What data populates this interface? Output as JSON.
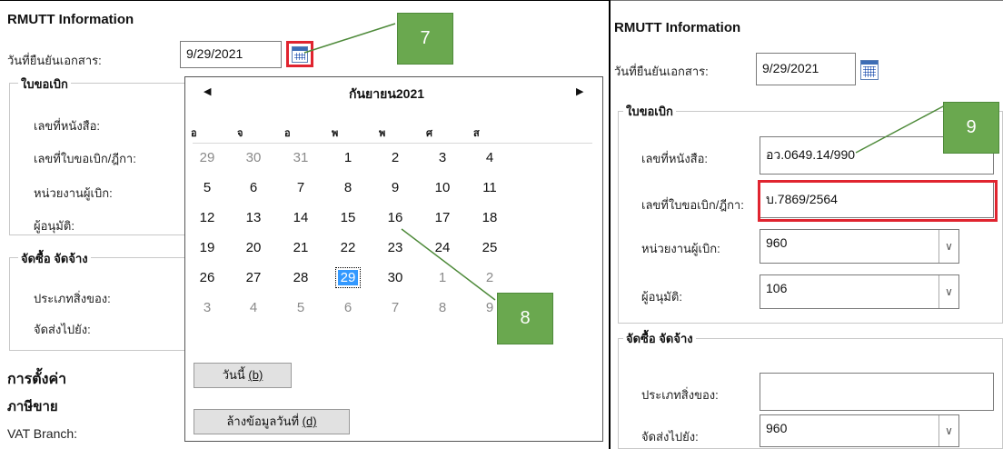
{
  "left": {
    "title": "RMUTT Information",
    "doc_date_label": "วันที่ยืนยันเอกสาร:",
    "doc_date_value": "9/29/2021",
    "group1_title": "ใบขอเบิก",
    "book_no_label": "เลขที่หนังสือ:",
    "req_no_label": "เลขที่ใบขอเบิก/ฎีกา:",
    "dept_label": "หน่วยงานผู้เบิก:",
    "approver_label": "ผู้อนุมัติ:",
    "group2_title": "จัดซื้อ จัดจ้าง",
    "item_type_label": "ประเภทสิ่งของ:",
    "ship_to_label": "จัดส่งไปยัง:",
    "settings_title": "การตั้งค่า",
    "tax_title": "ภาษีขาย",
    "vat_branch_label": "VAT Branch:"
  },
  "calendar": {
    "prev_icon": "caret-left-icon",
    "next_icon": "caret-right-icon",
    "month_title": "กันยายน2021",
    "weekdays": [
      "อ",
      "จ",
      "อ",
      "พ",
      "พ",
      "ศ",
      "ส"
    ],
    "weeks": [
      [
        "29",
        "30",
        "31",
        "1",
        "2",
        "3",
        "4"
      ],
      [
        "5",
        "6",
        "7",
        "8",
        "9",
        "10",
        "11"
      ],
      [
        "12",
        "13",
        "14",
        "15",
        "16",
        "17",
        "18"
      ],
      [
        "19",
        "20",
        "21",
        "22",
        "23",
        "24",
        "25"
      ],
      [
        "26",
        "27",
        "28",
        "29",
        "30",
        "1",
        "2"
      ],
      [
        "3",
        "4",
        "5",
        "6",
        "7",
        "8",
        "9"
      ]
    ],
    "today_label": "วันนี้",
    "today_key": "(b)",
    "clear_label": "ล้างข้อมูลวันที่",
    "clear_key": "(d)"
  },
  "right": {
    "title": "RMUTT Information",
    "doc_date_label": "วันที่ยืนยันเอกสาร:",
    "doc_date_value": "9/29/2021",
    "group1_title": "ใบขอเบิก",
    "book_no_label": "เลขที่หนังสือ:",
    "book_no_value": "อว.0649.14/990",
    "req_no_label": "เลขที่ใบขอเบิก/ฎีกา:",
    "req_no_value": "บ.7869/2564",
    "dept_label": "หน่วยงานผู้เบิก:",
    "dept_value": "960",
    "approver_label": "ผู้อนุมัติ:",
    "approver_value": "106",
    "group2_title": "จัดซื้อ จัดจ้าง",
    "item_type_label": "ประเภทสิ่งของ:",
    "item_type_value": "",
    "ship_to_label": "จัดส่งไปยัง:",
    "ship_to_value": "960"
  },
  "callouts": {
    "c7": "7",
    "c8": "8",
    "c9": "9"
  },
  "colors": {
    "highlight_red": "#e0242f",
    "callout_green": "#6aa84f",
    "selected_blue": "#3399ff"
  }
}
